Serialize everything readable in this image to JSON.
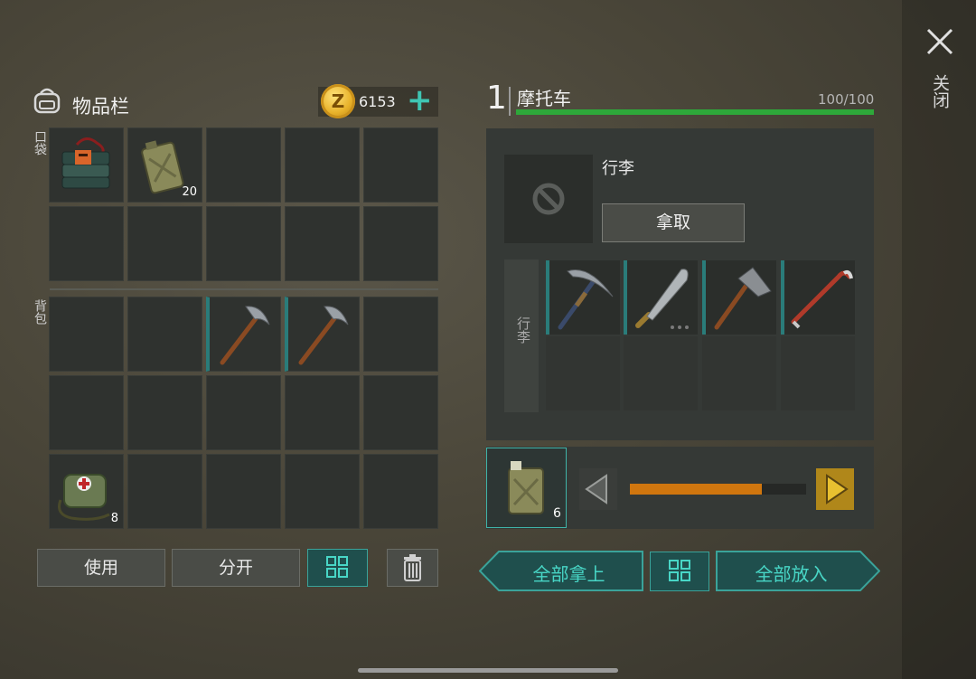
{
  "inventory": {
    "title": "物品栏",
    "pocket_label": "口袋",
    "backpack_label": "背包",
    "currency": "6153",
    "currency_plus": "+",
    "pocket_counts": [
      "",
      "20"
    ],
    "backpack_counts": [
      "8"
    ]
  },
  "actions": {
    "use": "使用",
    "split": "分开"
  },
  "close": {
    "label": "关闭"
  },
  "vehicle": {
    "number": "1",
    "name": "摩托车",
    "hp_text": "100/100",
    "hp_fraction": 1.0,
    "cargo_title": "行李",
    "take_button": "拿取",
    "cargo_side_label": "行李"
  },
  "transfer": {
    "count": "6",
    "quantity_fraction": 0.75,
    "take_all": "全部拿上",
    "put_all": "全部放入"
  },
  "colors": {
    "accent_teal": "#48d6c6",
    "hp_green": "#2ea83a",
    "qty_orange": "#d0760e"
  }
}
